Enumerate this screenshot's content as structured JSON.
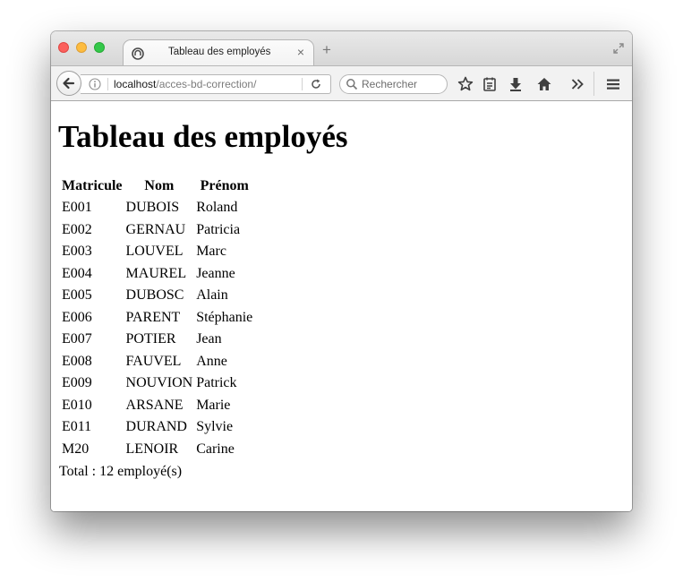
{
  "browser": {
    "tab_title": "Tableau des employés",
    "url_host": "localhost",
    "url_path": "/acces-bd-correction/",
    "search_placeholder": "Rechercher",
    "new_tab_symbol": "+",
    "close_tab_symbol": "×",
    "icons": [
      "back-arrow-icon",
      "info-icon",
      "reload-icon",
      "search-icon",
      "bookmark-star-icon",
      "reading-list-icon",
      "download-icon",
      "home-icon",
      "overflow-chevron-icon",
      "menu-icon"
    ]
  },
  "page": {
    "heading": "Tableau des employés",
    "columns": [
      "Matricule",
      "Nom",
      "Prénom"
    ],
    "rows": [
      [
        "E001",
        "DUBOIS",
        "Roland"
      ],
      [
        "E002",
        "GERNAU",
        "Patricia"
      ],
      [
        "E003",
        "LOUVEL",
        "Marc"
      ],
      [
        "E004",
        "MAUREL",
        "Jeanne"
      ],
      [
        "E005",
        "DUBOSC",
        "Alain"
      ],
      [
        "E006",
        "PARENT",
        "Stéphanie"
      ],
      [
        "E007",
        "POTIER",
        "Jean"
      ],
      [
        "E008",
        "FAUVEL",
        "Anne"
      ],
      [
        "E009",
        "NOUVION",
        "Patrick"
      ],
      [
        "E010",
        "ARSANE",
        "Marie"
      ],
      [
        "E011",
        "DURAND",
        "Sylvie"
      ],
      [
        "M20",
        "LENOIR",
        "Carine"
      ]
    ],
    "total": "Total : 12 employé(s)"
  },
  "colors": {
    "close": "#fc605c",
    "minimize": "#fdbc40",
    "maximize": "#34c84a"
  }
}
